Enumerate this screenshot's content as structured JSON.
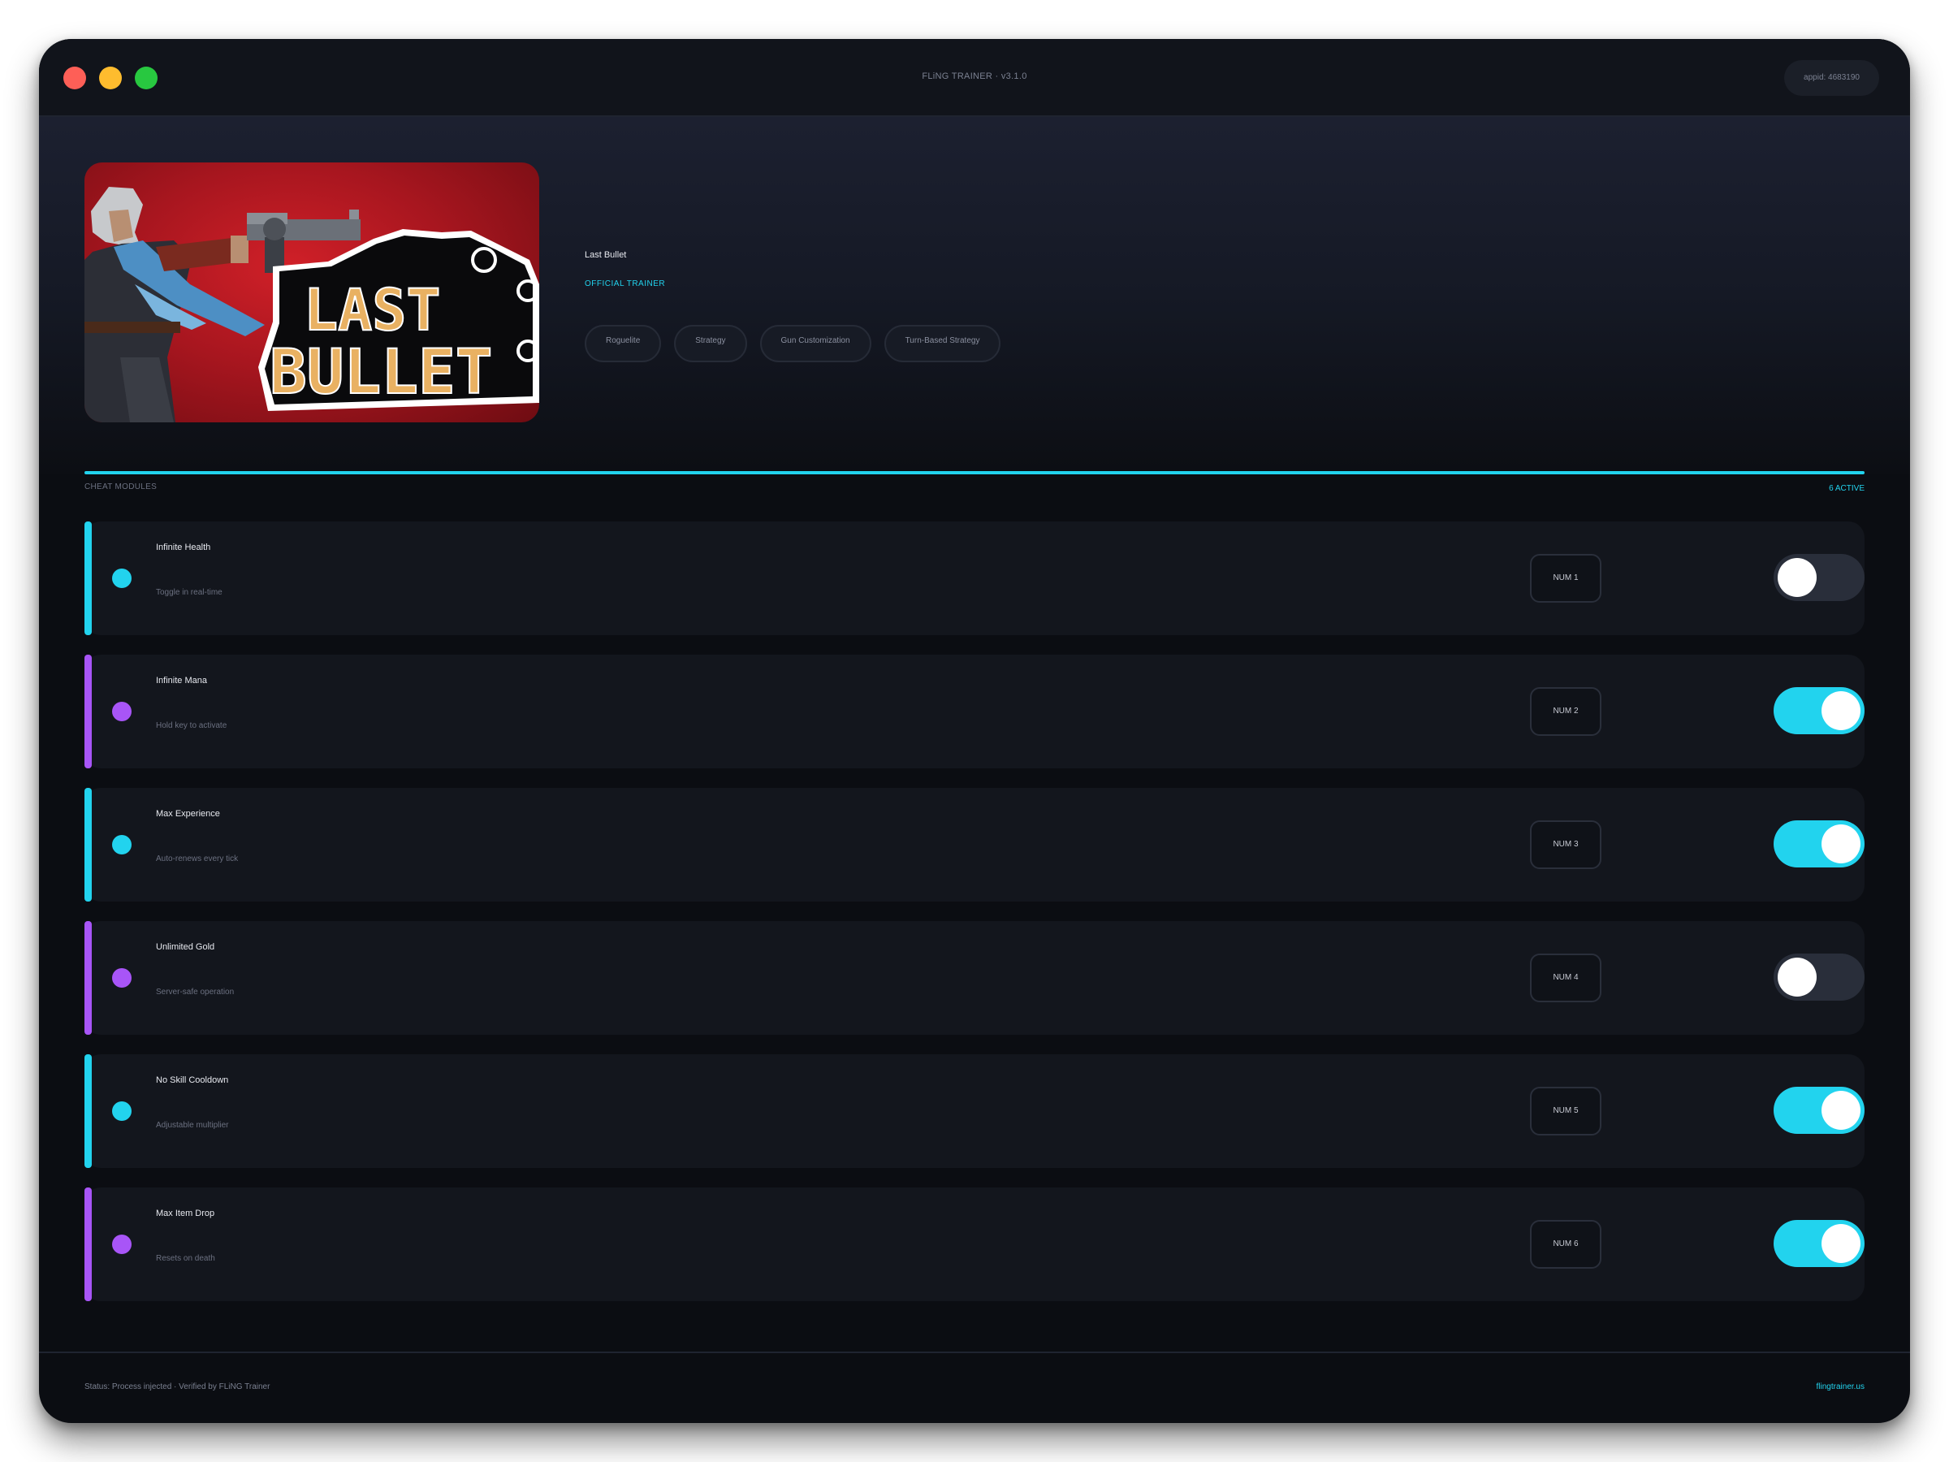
{
  "window": {
    "title": "FLiNG TRAINER · v3.1.0",
    "appid": "appid: 4683190"
  },
  "game": {
    "title": "Last Bullet",
    "cover_logo_line1": "LAST",
    "cover_logo_line2": "BULLET",
    "label": "OFFICIAL TRAINER",
    "tags": [
      "Roguelite",
      "Strategy",
      "Gun Customization",
      "Turn-Based Strategy"
    ]
  },
  "section": {
    "label": "CHEAT MODULES",
    "active_count": "6 ACTIVE"
  },
  "colors": {
    "cyan": "#22d3ee",
    "purple": "#a855f7",
    "toggle_off": "#292e3a"
  },
  "modules": [
    {
      "name": "Infinite Health",
      "desc": "Toggle in real-time",
      "key": "NUM 1",
      "accent": "cyan",
      "enabled": false
    },
    {
      "name": "Infinite Mana",
      "desc": "Hold key to activate",
      "key": "NUM 2",
      "accent": "purple",
      "enabled": true
    },
    {
      "name": "Max Experience",
      "desc": "Auto-renews every tick",
      "key": "NUM 3",
      "accent": "cyan",
      "enabled": true
    },
    {
      "name": "Unlimited Gold",
      "desc": "Server-safe operation",
      "key": "NUM 4",
      "accent": "purple",
      "enabled": false
    },
    {
      "name": "No Skill Cooldown",
      "desc": "Adjustable multiplier",
      "key": "NUM 5",
      "accent": "cyan",
      "enabled": true
    },
    {
      "name": "Max Item Drop",
      "desc": "Resets on death",
      "key": "NUM 6",
      "accent": "purple",
      "enabled": true
    }
  ],
  "footer": {
    "status": "Status: Process injected · Verified by FLiNG Trainer",
    "link": "flingtrainer.us"
  }
}
